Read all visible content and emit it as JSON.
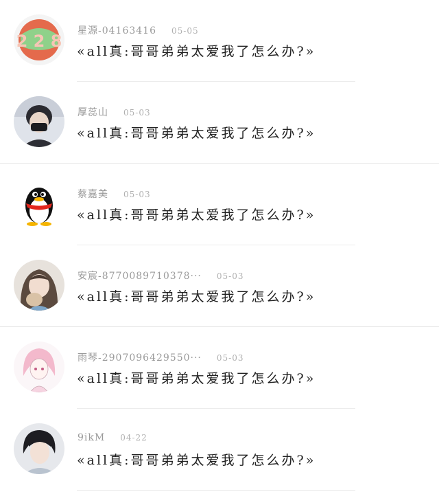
{
  "comments": [
    {
      "user": "星源-04163416",
      "date": "05-05",
      "text": "«all真:哥哥弟弟太爱我了怎么办?»",
      "avatar": "number-sticker-avatar"
    },
    {
      "user": "厚蕊山",
      "date": "05-03",
      "text": "«all真:哥哥弟弟太爱我了怎么办?»",
      "avatar": "masked-person-avatar"
    },
    {
      "user": "蔡嘉美",
      "date": "05-03",
      "text": "«all真:哥哥弟弟太爱我了怎么办?»",
      "avatar": "penguin-avatar"
    },
    {
      "user": "安宸-8770089710378···",
      "date": "05-03",
      "text": "«all真:哥哥弟弟太爱我了怎么办?»",
      "avatar": "anime-girl-cat-avatar"
    },
    {
      "user": "雨琴-2907096429550···",
      "date": "05-03",
      "text": "«all真:哥哥弟弟太爱我了怎么办?»",
      "avatar": "pink-sketch-avatar"
    },
    {
      "user": "9ikM",
      "date": "04-22",
      "text": "«all真:哥哥弟弟太爱我了怎么办?»",
      "avatar": "boy-portrait-avatar"
    }
  ],
  "colors": {
    "text": "#222222",
    "meta": "#9a9a9a",
    "divider": "#ececec"
  }
}
